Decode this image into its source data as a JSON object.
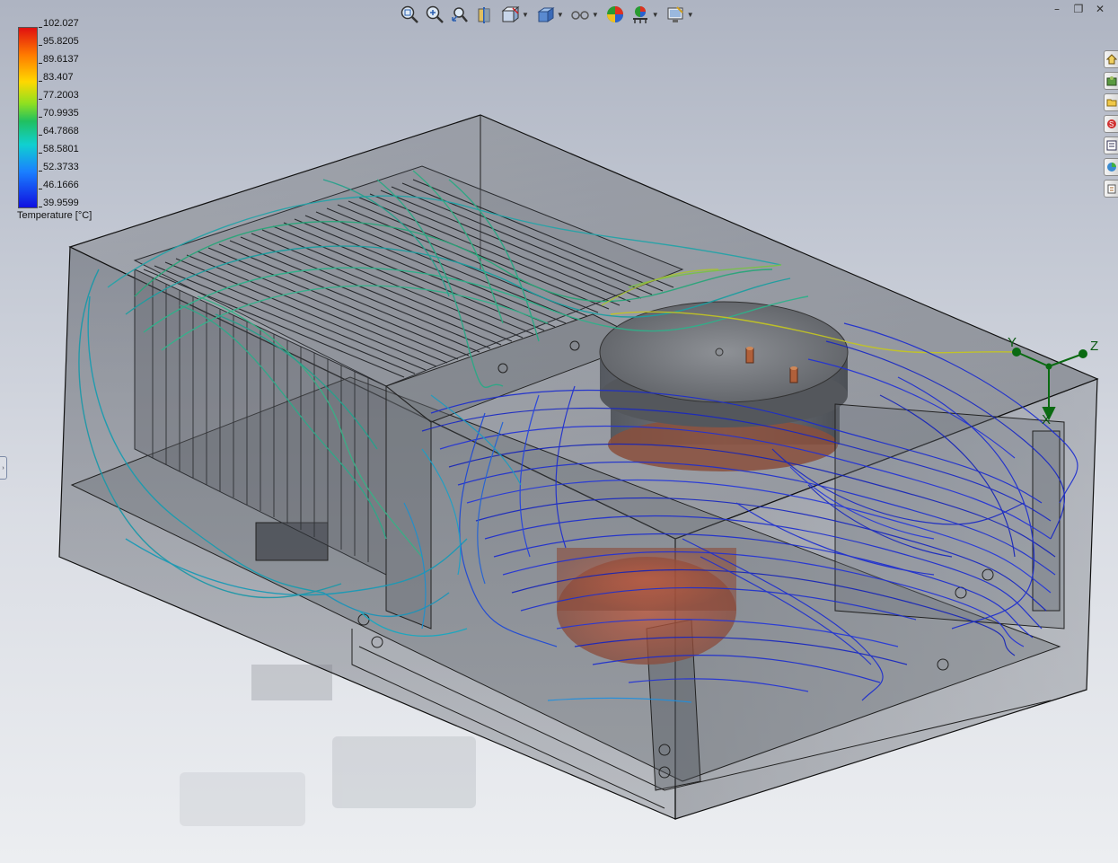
{
  "toolbar": {
    "items": [
      {
        "name": "zoom-to-fit"
      },
      {
        "name": "zoom-to-area"
      },
      {
        "name": "previous-view"
      },
      {
        "name": "section-view"
      },
      {
        "name": "view-orientation"
      },
      {
        "name": "display-style"
      },
      {
        "name": "hide-show-items"
      },
      {
        "name": "edit-appearance"
      },
      {
        "name": "apply-scene"
      },
      {
        "name": "view-settings"
      }
    ]
  },
  "legend": {
    "title": "Temperature [°C]",
    "values": [
      "102.027",
      "95.8205",
      "89.6137",
      "83.407",
      "77.2003",
      "70.9935",
      "64.7868",
      "58.5801",
      "52.3733",
      "46.1666",
      "39.9599"
    ],
    "min": 39.9599,
    "max": 102.027,
    "colors": [
      "#e01010",
      "#ff7a00",
      "#ffd800",
      "#90e020",
      "#20c060",
      "#10d0d0",
      "#1a80ff",
      "#1010e0"
    ]
  },
  "triad": {
    "x_label": "X",
    "y_label": "Y",
    "z_label": "Z",
    "color": "#0a6a12"
  },
  "colors": {
    "flow_cool": "#1a2bd0",
    "flow_mid": "#1aa0b8",
    "flow_warm": "#2fae7a",
    "flow_hot": "#c8c82a",
    "housing": "#6a6f78",
    "canister": "#7a7e84",
    "canister_hot": "#b85a3a"
  }
}
